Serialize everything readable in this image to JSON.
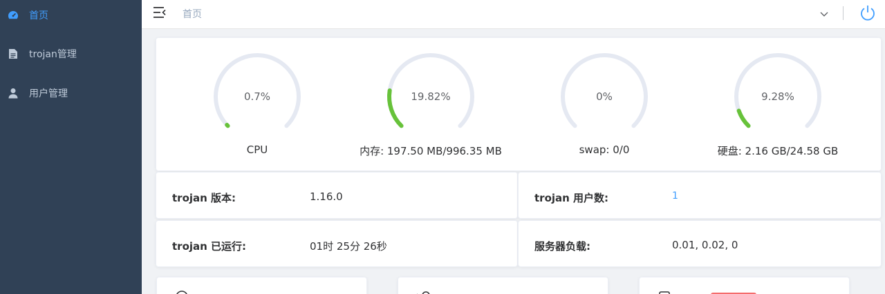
{
  "sidebar": {
    "items": [
      {
        "label": "首页",
        "icon": "dashboard-icon",
        "active": true
      },
      {
        "label": "trojan管理",
        "icon": "document-icon",
        "active": false
      },
      {
        "label": "用户管理",
        "icon": "user-icon",
        "active": false
      }
    ]
  },
  "header": {
    "breadcrumb": "首页"
  },
  "gauges": [
    {
      "percent": 0.7,
      "percent_label": "0.7%",
      "caption": "CPU"
    },
    {
      "percent": 19.82,
      "percent_label": "19.82%",
      "caption": "内存: 197.50 MB/996.35 MB"
    },
    {
      "percent": 0,
      "percent_label": "0%",
      "caption": "swap: 0/0"
    },
    {
      "percent": 9.28,
      "percent_label": "9.28%",
      "caption": "硬盘: 2.16 GB/24.58 GB"
    }
  ],
  "info": {
    "version_label": "trojan 版本:",
    "version_value": "1.16.0",
    "users_label": "trojan 用户数:",
    "users_value": "1",
    "uptime_label": "trojan 已运行:",
    "uptime_value": "01时 25分 26秒",
    "load_label": "服务器负载:",
    "load_value": "0.01, 0.02, 0"
  },
  "colors": {
    "sidebar_bg": "#304156",
    "accent": "#409eff",
    "gauge_fill": "#67c23a",
    "gauge_track": "#e5e9f2"
  }
}
